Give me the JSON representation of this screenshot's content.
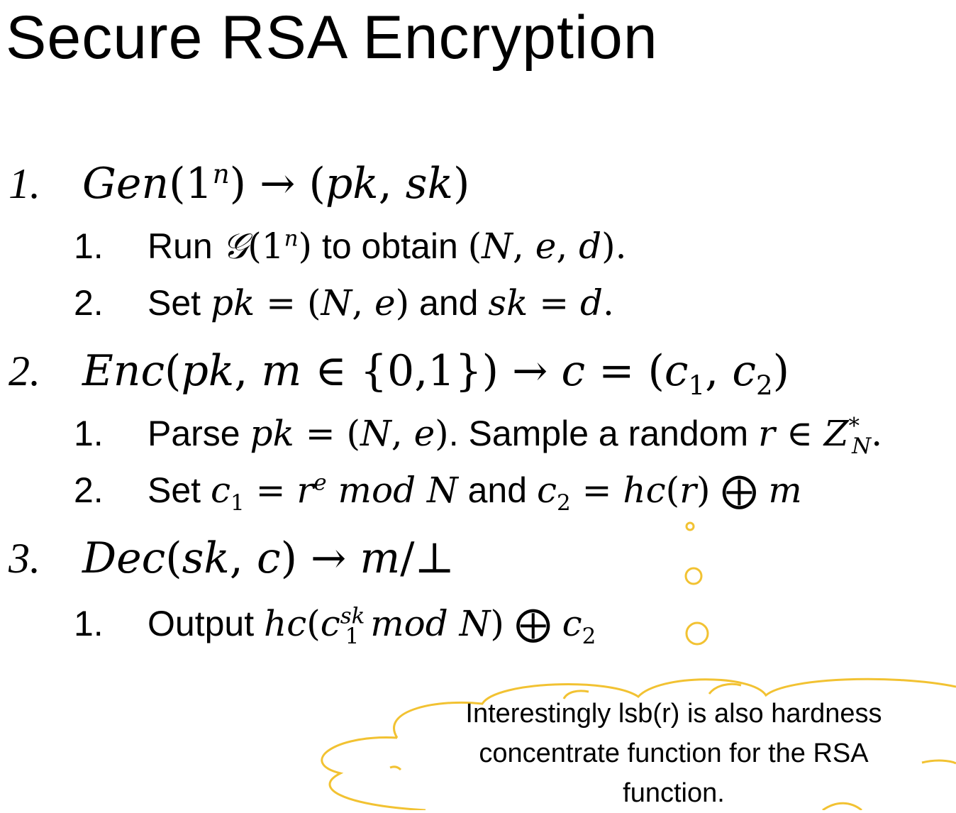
{
  "title": "Secure RSA Encryption",
  "steps": [
    {
      "number": "1.",
      "heading": "Gen(1ⁿ) → (pk, sk)",
      "items": [
        {
          "number": "1.",
          "text": "Run 𝒢(1ⁿ) to obtain (N, e, d)."
        },
        {
          "number": "2.",
          "text": "Set pk = (N, e) and sk = d."
        }
      ]
    },
    {
      "number": "2.",
      "heading": "Enc(pk, m ∈ {0,1}) → c = (c₁, c₂)",
      "items": [
        {
          "number": "1.",
          "text": "Parse pk = (N, e). Sample a random r ∈ Z*N."
        },
        {
          "number": "2.",
          "text": "Set c₁ = rᵉ mod N and c₂ = hc(r) ⨁ m"
        }
      ]
    },
    {
      "number": "3.",
      "heading": "Dec(sk, c) → m/⊥",
      "items": [
        {
          "number": "1.",
          "text": "Output hc(c₁ˢᵏ mod N) ⨁ c₂"
        }
      ]
    }
  ],
  "callout": {
    "lines": [
      "Interestingly lsb(r) is also hardness",
      "concentrate function for the RSA",
      "function."
    ],
    "stroke_color": "#F2C232"
  }
}
